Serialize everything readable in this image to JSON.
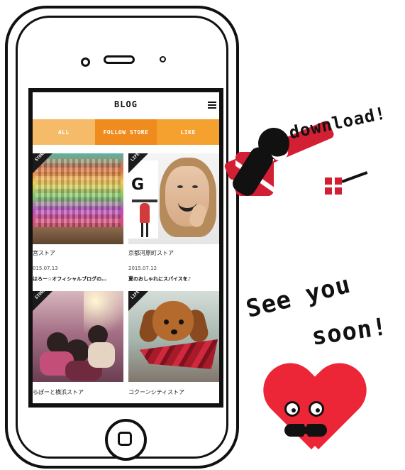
{
  "phone": {
    "screen": {
      "header": {
        "title": "BLOG"
      },
      "tabs": [
        {
          "label": "ALL"
        },
        {
          "label": "FOLLOW STORE"
        },
        {
          "label": "LIKE"
        }
      ],
      "cards": [
        {
          "ribbon": "STORE",
          "store": "宮ストア",
          "date": "015.07.13",
          "title": "はろー☆オフィシャルブログの…"
        },
        {
          "ribbon": "LIFE",
          "store": "京都河原町ストア",
          "date": "2015.07.12",
          "title": "夏のおしゃれにスパイスを♪"
        },
        {
          "ribbon": "STORE",
          "store": "らぽーと横浜ストア"
        },
        {
          "ribbon": "LIFE",
          "store": "コクーンシティストア"
        }
      ]
    }
  },
  "illustrations": {
    "download_text": "download!",
    "see_you_text": "See you",
    "soon_text": "soon!"
  },
  "colors": {
    "orange": "#f5a12f",
    "orange_dark": "#f08b1d",
    "orange_light": "#f6bb69",
    "red": "#d31f34",
    "heart_red": "#ec2636"
  },
  "icons": {
    "menu": "menu-icon",
    "home": "home-button-icon"
  }
}
